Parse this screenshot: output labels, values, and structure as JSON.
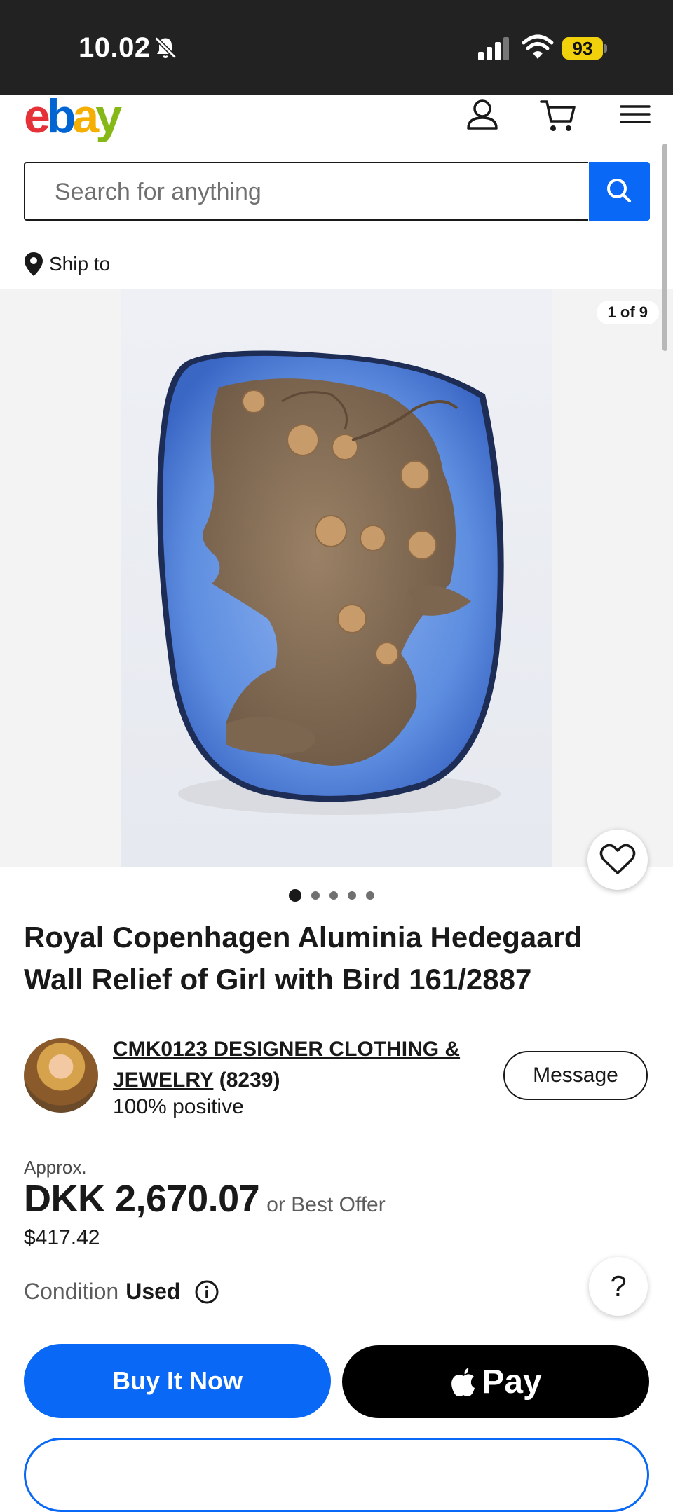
{
  "status_bar": {
    "time": "10.02",
    "battery": "93"
  },
  "header": {
    "logo_letters": [
      "e",
      "b",
      "a",
      "y"
    ],
    "search_placeholder": "Search for anything",
    "ship_to": "Ship to"
  },
  "gallery": {
    "counter": "1 of 9",
    "dots": 5,
    "active_dot": 0
  },
  "listing": {
    "title": "Royal Copenhagen Aluminia Hedegaard Wall Relief of Girl with Bird 161/2887"
  },
  "seller": {
    "name_line1": "CMK0123 DESIGNER CLOTHING &",
    "name_line2": "JEWELRY",
    "count": "(8239)",
    "positive": "100% positive",
    "message_label": "Message"
  },
  "price": {
    "approx": "Approx.",
    "amount": "DKK 2,670.07",
    "best_offer": "or Best Offer",
    "usd": "$417.42"
  },
  "condition": {
    "label": "Condition",
    "value": "Used"
  },
  "help_label": "?",
  "actions": {
    "buy_now": "Buy It Now",
    "apple_pay": "Pay"
  },
  "colors": {
    "ebay_blue": "#0968f6",
    "status_bg": "#222222",
    "battery": "#f1d10b"
  }
}
